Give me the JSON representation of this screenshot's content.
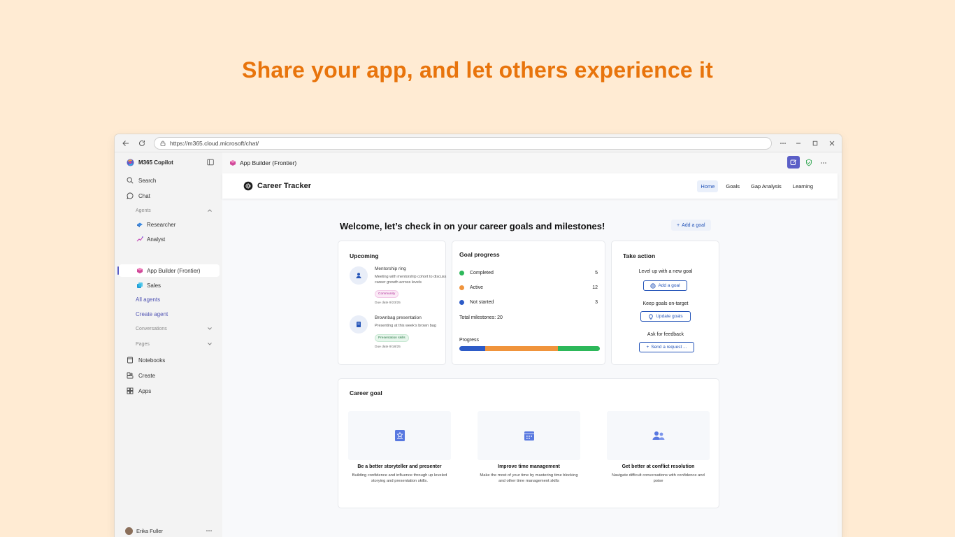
{
  "headline": "Share your app, and let others experience it",
  "browser": {
    "url": "https://m365.cloud.microsoft/chat/"
  },
  "sidebar": {
    "app_name": "M365 Copilot",
    "search": "Search",
    "chat": "Chat",
    "agents_section": "Agents",
    "agents": [
      {
        "label": "Researcher"
      },
      {
        "label": "Analyst"
      },
      {
        "label": "App Builder (Frontier)"
      },
      {
        "label": "Sales"
      }
    ],
    "all_agents": "All agents",
    "create_agent": "Create agent",
    "conversations_section": "Conversations",
    "pages_section": "Pages",
    "notebooks": "Notebooks",
    "create": "Create",
    "apps": "Apps",
    "user_name": "Erika Fuller"
  },
  "topbar": {
    "title": "App Builder (Frontier)"
  },
  "app": {
    "brand": "Career Tracker",
    "nav": [
      "Home",
      "Goals",
      "Gap Analysis",
      "Learning"
    ],
    "welcome": "Welcome, let’s check in on your career goals and milestones!",
    "add_goal_top": "Add a goal"
  },
  "upcoming": {
    "title": "Upcoming",
    "items": [
      {
        "title": "Mentorship ring",
        "desc": "Meeting with mentorship cohort to discuss career growth across levels",
        "tag": "Community",
        "due": "Due date 9/23/25"
      },
      {
        "title": "Brownbag presentation",
        "desc": "Presenting at this week's brown bag",
        "tag": "Presentation skills",
        "due": "Due date 9/18/25"
      }
    ]
  },
  "goal_progress": {
    "title": "Goal progress",
    "rows": [
      {
        "label": "Completed",
        "value": "5",
        "color": "#2DB85A"
      },
      {
        "label": "Active",
        "value": "12",
        "color": "#F0943C"
      },
      {
        "label": "Not started",
        "value": "3",
        "color": "#2D5BC7"
      }
    ],
    "total": "Total milestones: 20",
    "progress_label": "Progress",
    "bar": [
      {
        "share": 0.185,
        "color": "#2D5BC7"
      },
      {
        "share": 0.515,
        "color": "#F0943C"
      },
      {
        "share": 0.3,
        "color": "#2DB85A"
      }
    ]
  },
  "take_action": {
    "title": "Take action",
    "items": [
      {
        "label": "Level up with a new goal",
        "button": "Add a goal",
        "icon": "target-icon"
      },
      {
        "label": "Keep goals on-target",
        "button": "Update goals",
        "icon": "lightbulb-icon"
      },
      {
        "label": "Ask for feedback",
        "button": "Send a request ...",
        "icon": "plus-icon"
      }
    ]
  },
  "career_goal": {
    "title": "Career goal",
    "goals": [
      {
        "title": "Be a better storyteller and presenter",
        "desc": "Building confidence and influence through up leveled storying and presentation skills.",
        "icon": "star-book-icon"
      },
      {
        "title": "Improve time management",
        "desc": "Make the most of your time by mastering time blocking and other time management skills",
        "icon": "calendar-icon"
      },
      {
        "title": "Get better at conflict resolution",
        "desc": "Navigate difficult conversations with confidence and poise",
        "icon": "people-icon"
      }
    ]
  },
  "colors": {
    "accent": "#2454B8",
    "headline": "#E8740C",
    "page_bg": "#FFEBD3",
    "copilot_purple": "#5B5FC7"
  }
}
